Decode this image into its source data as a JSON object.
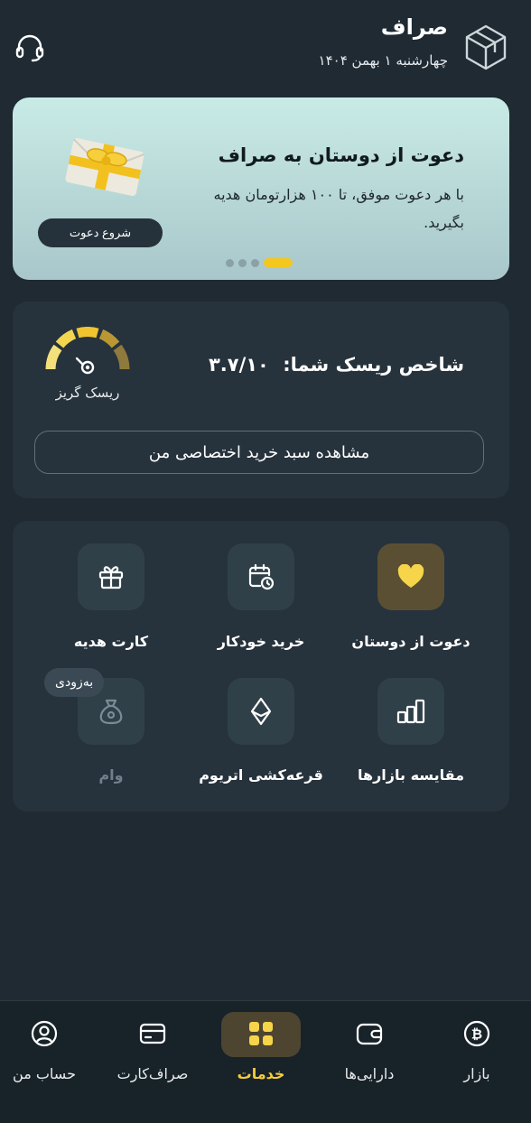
{
  "header": {
    "title": "صراف",
    "date": "چهارشنبه ۱ بهمن ۱۴۰۴"
  },
  "banner": {
    "title": "دعوت از دوستان به صراف",
    "body": "با هر دعوت موفق، تا ۱۰۰ هزارتومان هدیه بگیرید.",
    "button": "شروع دعوت",
    "slides_total": 4,
    "active_slide": 4
  },
  "risk": {
    "label": "شاخص ریسک شما:",
    "score": "۳.۷/۱۰",
    "score_value": 3.7,
    "gauge_label": "ریسک گریز",
    "basket_button": "مشاهده سبد خرید اختصاصی من"
  },
  "services": {
    "items": [
      {
        "label": "دعوت از دوستان",
        "icon": "heart-icon"
      },
      {
        "label": "خرید خودکار",
        "icon": "calendar-clock-icon"
      },
      {
        "label": "کارت هدیه",
        "icon": "gift-icon"
      },
      {
        "label": "مقایسه بازارها",
        "icon": "bar-chart-icon"
      },
      {
        "label": "قرعه‌کشی اتریوم",
        "icon": "ethereum-icon"
      },
      {
        "label": "وام",
        "icon": "money-bag-icon"
      }
    ],
    "soon_badge": "به‌زودی"
  },
  "nav": {
    "items": [
      {
        "label": "بازار",
        "icon": "bitcoin-icon"
      },
      {
        "label": "دارایی‌ها",
        "icon": "wallet-icon"
      },
      {
        "label": "خدمات",
        "icon": "grid-icon"
      },
      {
        "label": "صراف‌کارت",
        "icon": "card-icon"
      },
      {
        "label": "حساب من",
        "icon": "user-icon"
      }
    ],
    "active": "خدمات"
  },
  "colors": {
    "background": "#1f2a33",
    "card": "#26323c",
    "accent": "#f3c71e",
    "banner": "#c9ebe6"
  }
}
